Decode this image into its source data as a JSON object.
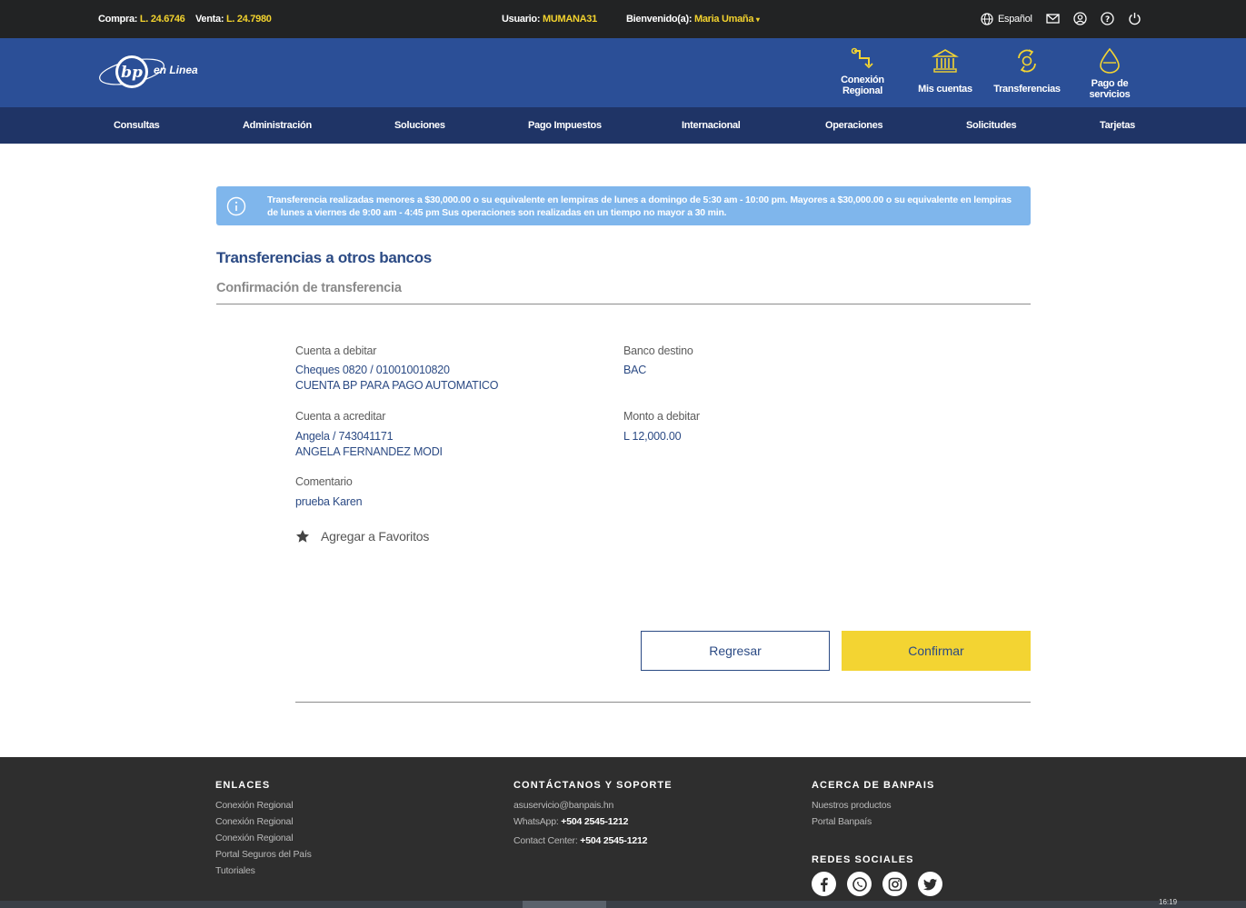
{
  "topbar": {
    "compra_label": "Compra:",
    "compra_value": "L. 24.6746",
    "venta_label": "Venta:",
    "venta_value": "L. 24.7980",
    "usuario_label": "Usuario:",
    "usuario_value": "MUMANA31",
    "bienvenido_label": "Bienvenido(a):",
    "bienvenido_value": "Maria Umaña",
    "language": "Español"
  },
  "quick_links": [
    {
      "label": "Conexión Regional",
      "icon": "route-icon"
    },
    {
      "label": "Mis cuentas",
      "icon": "bank-icon"
    },
    {
      "label": "Transferencias",
      "icon": "transfer-icon"
    },
    {
      "label": "Pago de servicios",
      "icon": "droplet-icon"
    }
  ],
  "logo_text": "en Linea",
  "nav": [
    "Consultas",
    "Administración",
    "Soluciones",
    "Pago Impuestos",
    "Internacional",
    "Operaciones",
    "Solicitudes",
    "Tarjetas"
  ],
  "alert": "Transferencia realizadas menores a $30,000.00 o su equivalente en lempiras de lunes a domingo de 5:30 am - 10:00 pm. Mayores a $30,000.00 o su equivalente en lempiras de lunes a viernes de 9:00 am - 4:45 pm Sus operaciones son realizadas en un tiempo no mayor a 30 min.",
  "page": {
    "title": "Transferencias a otros bancos",
    "subtitle": "Confirmación de transferencia"
  },
  "details": {
    "cuenta_debitar_label": "Cuenta a debitar",
    "cuenta_debitar_line1": "Cheques 0820 / 010010010820",
    "cuenta_debitar_line2": "CUENTA BP PARA PAGO AUTOMATICO",
    "banco_destino_label": "Banco destino",
    "banco_destino_value": "BAC",
    "cuenta_acreditar_label": "Cuenta a acreditar",
    "cuenta_acreditar_line1": "Angela / 743041171",
    "cuenta_acreditar_line2": "ANGELA FERNANDEZ MODI",
    "monto_label": "Monto a debitar",
    "monto_value": "L 12,000.00",
    "comentario_label": "Comentario",
    "comentario_value": "prueba Karen"
  },
  "favorites_label": "Agregar a Favoritos",
  "buttons": {
    "back": "Regresar",
    "confirm": "Confirmar"
  },
  "footer": {
    "enlaces_title": "ENLACES",
    "enlaces": [
      "Conexión Regional",
      "Conexión Regional",
      "Conexión Regional",
      "Portal Seguros del País",
      "Tutoriales"
    ],
    "contacto_title": "CONTÁCTANOS Y SOPORTE",
    "email": "asuservicio@banpais.hn",
    "whatsapp_label": "WhatsApp:",
    "whatsapp_value": "+504 2545-1212",
    "contact_label": "Contact Center:",
    "contact_value": "+504 2545-1212",
    "acerca_title": "ACERCA DE BANPAIS",
    "acerca": [
      "Nuestros productos",
      "Portal Banpaís"
    ],
    "redes_title": "REDES SOCIALES"
  },
  "taskbar_clock": "16:19",
  "colors": {
    "primary": "#2b4f97",
    "nav": "#1f3466",
    "accent": "#f3d432",
    "text_blue": "#2b4a84"
  }
}
